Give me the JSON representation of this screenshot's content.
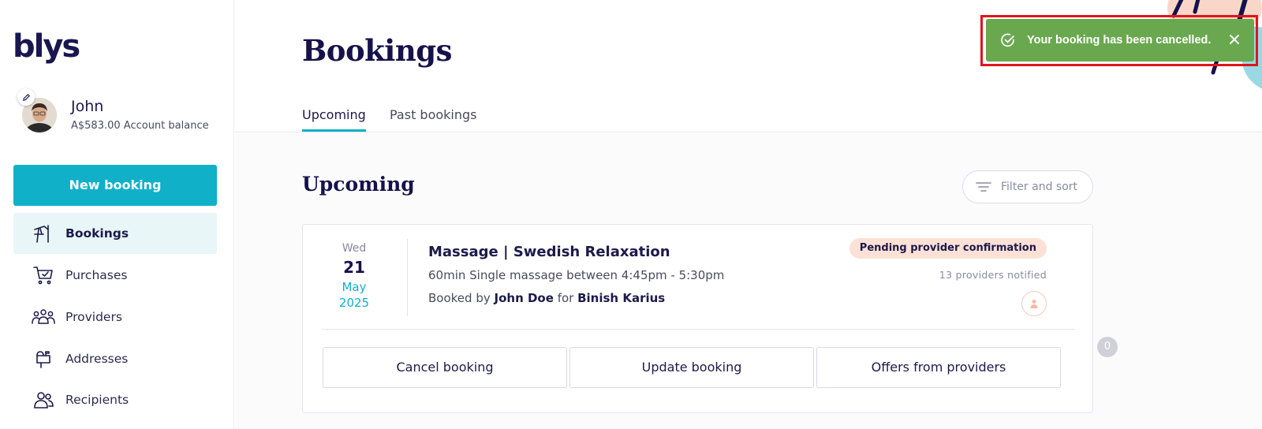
{
  "brand": {
    "logo_text": "blys",
    "accent": "#10b0c9"
  },
  "user": {
    "name": "John",
    "balance": "A$583.00 Account balance"
  },
  "sidebar": {
    "new_booking_label": "New booking",
    "items": [
      {
        "label": "Bookings",
        "icon": "umbrella-table-icon",
        "active": true
      },
      {
        "label": "Purchases",
        "icon": "cart-icon",
        "active": false
      },
      {
        "label": "Providers",
        "icon": "people-group-icon",
        "active": false
      },
      {
        "label": "Addresses",
        "icon": "mailbox-icon",
        "active": false
      },
      {
        "label": "Recipients",
        "icon": "users-icon",
        "active": false
      }
    ]
  },
  "header": {
    "title": "Bookings",
    "tabs": [
      {
        "label": "Upcoming",
        "active": true
      },
      {
        "label": "Past bookings",
        "active": false
      }
    ]
  },
  "content": {
    "section_title": "Upcoming",
    "filter_label": "Filter and sort",
    "booking": {
      "day": "Wed",
      "date": "21",
      "month": "May",
      "year": "2025",
      "title": "Massage | Swedish Relaxation",
      "description": "60min Single massage between 4:45pm - 5:30pm",
      "booked_by_prefix": "Booked by",
      "booked_by": "John Doe",
      "for_word": "for",
      "recipient": "Binish Karius",
      "status": "Pending provider confirmation",
      "providers_notified": "13 providers notified",
      "actions": {
        "cancel": "Cancel booking",
        "update": "Update booking",
        "offers": "Offers from providers",
        "offers_count": "0"
      }
    }
  },
  "toast": {
    "message": "Your booking has been cancelled.",
    "color": "#6aa84f"
  }
}
